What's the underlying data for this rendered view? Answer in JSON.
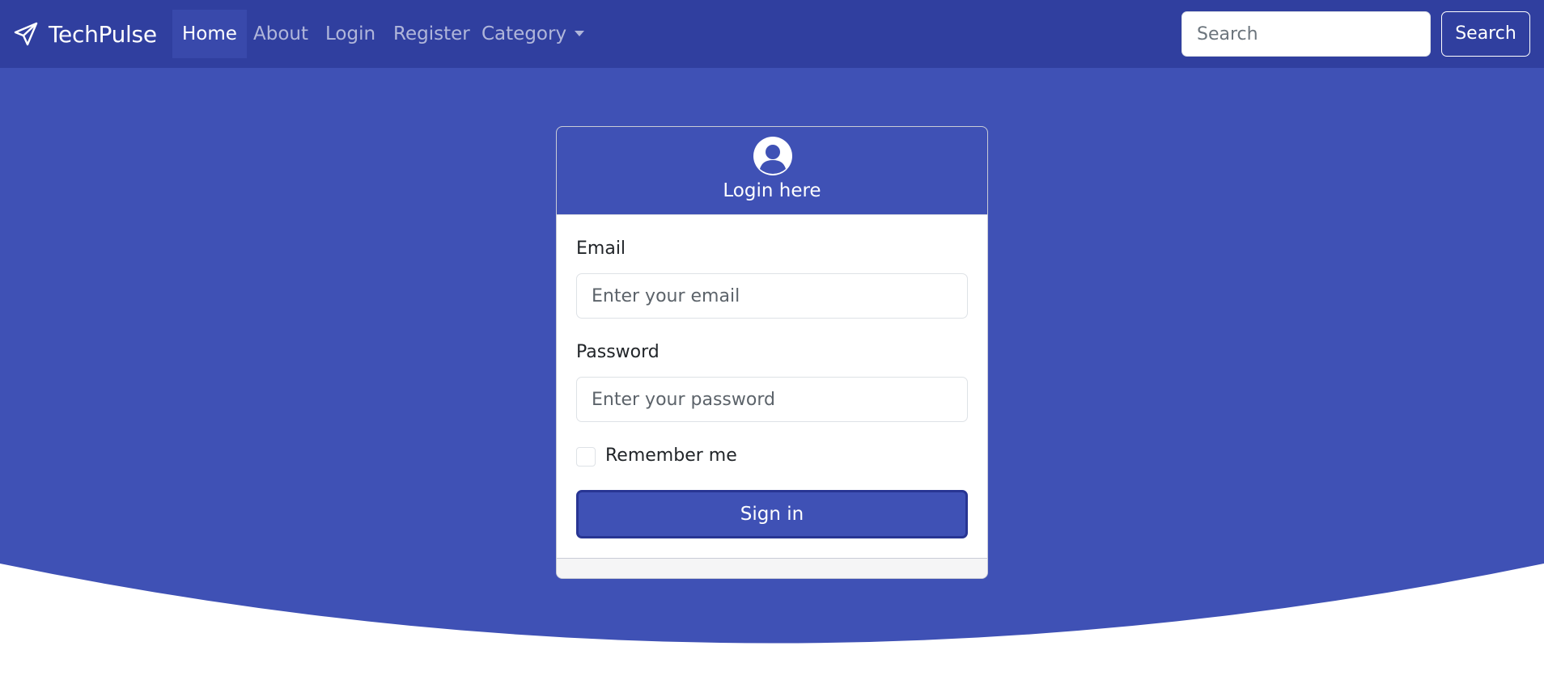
{
  "navbar": {
    "brand": "TechPulse",
    "brand_icon": "paper-plane-icon",
    "items": [
      {
        "label": "Home",
        "active": true
      },
      {
        "label": "About",
        "active": false
      },
      {
        "label": "Login",
        "active": false
      },
      {
        "label": "Register",
        "active": false
      },
      {
        "label": "Category",
        "active": false,
        "dropdown": true
      }
    ],
    "search": {
      "placeholder": "Search",
      "button_label": "Search"
    }
  },
  "login_card": {
    "header_icon": "user-circle-icon",
    "title": "Login here",
    "email": {
      "label": "Email",
      "placeholder": "Enter your email",
      "value": ""
    },
    "password": {
      "label": "Password",
      "placeholder": "Enter your password",
      "value": ""
    },
    "remember": {
      "label": "Remember me",
      "checked": false
    },
    "submit_label": "Sign in"
  },
  "colors": {
    "navbar_bg": "#303f9f",
    "primary": "#3f51b5",
    "button_border": "#283593",
    "page_bg": "#ffffff"
  }
}
